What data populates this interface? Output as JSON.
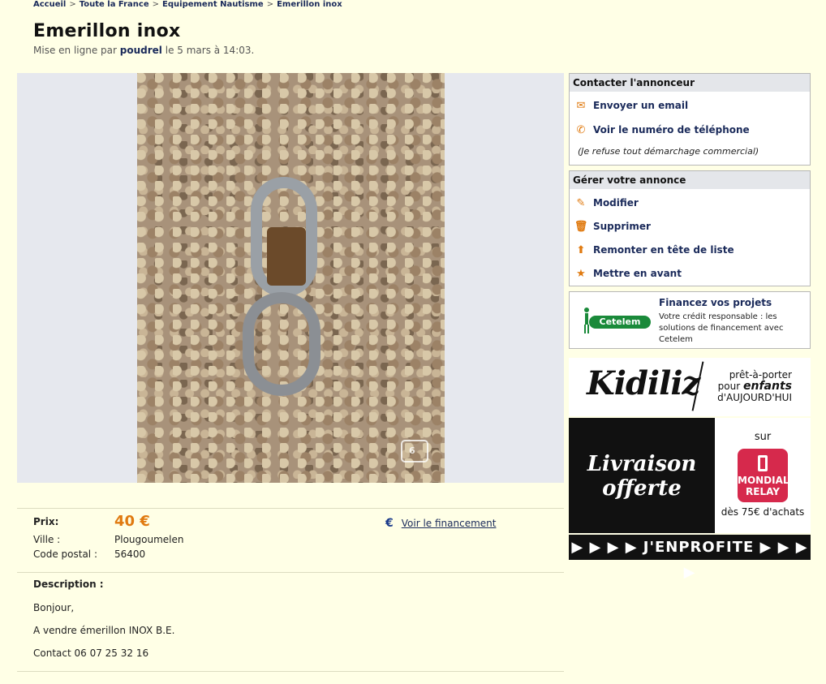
{
  "breadcrumb": [
    "Accueil",
    "Toute la France",
    "Equipement Nautisme",
    "Emerillon inox"
  ],
  "title": "Emerillon inox",
  "posted": {
    "prefix": "Mise en ligne par",
    "user": "poudrel",
    "date": "le 5 mars à 14:03."
  },
  "info": {
    "price_label": "Prix:",
    "price": "40 €",
    "city_label": "Ville :",
    "city": "Plougoumelen",
    "zip_label": "Code postal :",
    "zip": "56400",
    "financing_link": "Voir le financement"
  },
  "description": {
    "label": "Description :",
    "lines": [
      "Bonjour,",
      "A vendre émerillon INOX B.E.",
      "Contact 06 07 25 32 16"
    ]
  },
  "contact_box": {
    "title": "Contacter l'annonceur",
    "email": "Envoyer un email",
    "phone": "Voir le numéro de téléphone",
    "note": "(Je refuse tout démarchage commercial)"
  },
  "manage_box": {
    "title": "Gérer votre annonce",
    "items": [
      "Modifier",
      "Supprimer",
      "Remonter en tête de liste",
      "Mettre en avant"
    ]
  },
  "cetelem": {
    "logo": "Cetelem",
    "title": "Financez vos projets",
    "text": "Votre crédit responsable : les solutions de financement avec Cetelem"
  },
  "ad": {
    "brand": "Kidiliz",
    "tag1": "prêt-à-porter",
    "tag2": "pour",
    "tag3": "enfants",
    "tag4": "d'AUJOURD'HUI",
    "livraison": "Livraison offerte",
    "sur": "sur",
    "relay": "MONDIAL RELAY",
    "price": "dès 75€ d'achats",
    "cta": "▶ ▶ ▶ ▶ J'ENPROFITE ▶ ▶ ▶ ▶"
  }
}
